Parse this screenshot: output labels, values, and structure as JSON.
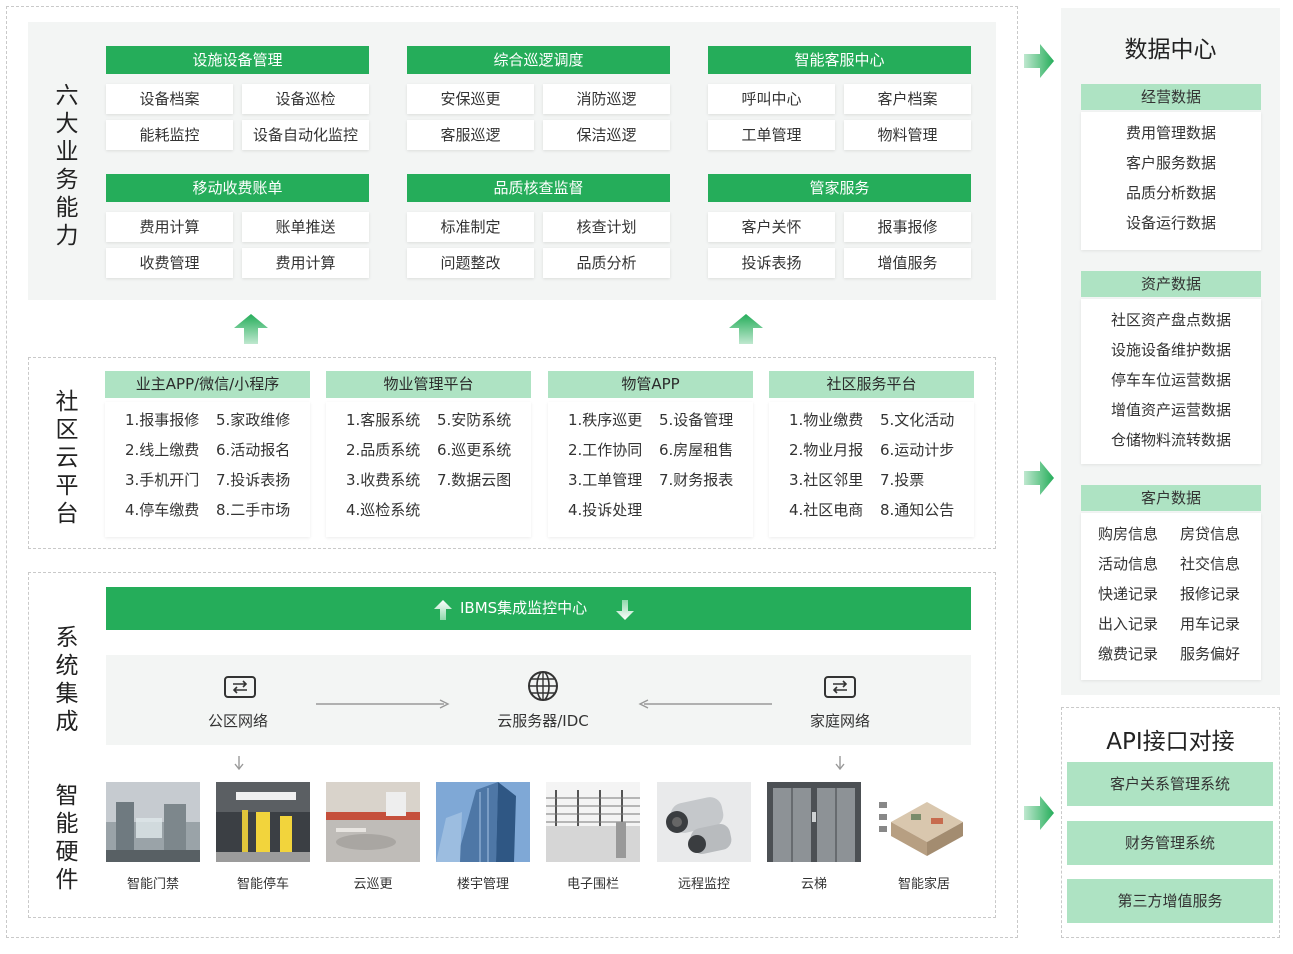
{
  "layers": {
    "business": "六大业务能力",
    "cloud": "社区云平台",
    "integration": "系统集成",
    "hardware": "智能硬件"
  },
  "business_groups": [
    {
      "title": "设施设备管理",
      "items": [
        "设备档案",
        "设备巡检",
        "能耗监控",
        "设备自动化监控"
      ]
    },
    {
      "title": "综合巡逻调度",
      "items": [
        "安保巡更",
        "消防巡逻",
        "客服巡逻",
        "保洁巡逻"
      ]
    },
    {
      "title": "智能客服中心",
      "items": [
        "呼叫中心",
        "客户档案",
        "工单管理",
        "物料管理"
      ]
    },
    {
      "title": "移动收费账单",
      "items": [
        "费用计算",
        "账单推送",
        "收费管理",
        "费用计算"
      ]
    },
    {
      "title": "品质核查监督",
      "items": [
        "标准制定",
        "核查计划",
        "问题整改",
        "品质分析"
      ]
    },
    {
      "title": "管家服务",
      "items": [
        "客户关怀",
        "报事报修",
        "投诉表扬",
        "增值服务"
      ]
    }
  ],
  "platforms": [
    {
      "title": "业主APP/微信/小程序",
      "left": [
        "1.报事报修",
        "2.线上缴费",
        "3.手机开门",
        "4.停车缴费"
      ],
      "right": [
        "5.家政维修",
        "6.活动报名",
        "7.投诉表扬",
        "8.二手市场"
      ]
    },
    {
      "title": "物业管理平台",
      "left": [
        "1.客服系统",
        "2.品质系统",
        "3.收费系统",
        "4.巡检系统"
      ],
      "right": [
        "5.安防系统",
        "6.巡更系统",
        "7.数据云图"
      ]
    },
    {
      "title": "物管APP",
      "left": [
        "1.秩序巡更",
        "2.工作协同",
        "3.工单管理",
        "4.投诉处理"
      ],
      "right": [
        "5.设备管理",
        "6.房屋租售",
        "7.财务报表"
      ]
    },
    {
      "title": "社区服务平台",
      "left": [
        "1.物业缴费",
        "2.物业月报",
        "3.社区邻里",
        "4.社区电商"
      ],
      "right": [
        "5.文化活动",
        "6.运动计步",
        "7.投票",
        "8.通知公告"
      ]
    }
  ],
  "ibms": "IBMS集成监控中心",
  "network": {
    "public": "公区网络",
    "cloud": "云服务器/IDC",
    "home": "家庭网络"
  },
  "hardware": [
    "智能门禁",
    "智能停车",
    "云巡更",
    "楼宇管理",
    "电子围栏",
    "远程监控",
    "云梯",
    "智能家居"
  ],
  "data_center": {
    "title": "数据中心",
    "groups": [
      {
        "title": "经营数据",
        "items": [
          "费用管理数据",
          "客户服务数据",
          "品质分析数据",
          "设备运行数据"
        ]
      },
      {
        "title": "资产数据",
        "items": [
          "社区资产盘点数据",
          "设施设备维护数据",
          "停车车位运营数据",
          "增值资产运营数据",
          "仓储物料流转数据"
        ]
      },
      {
        "title": "客户数据",
        "left": [
          "购房信息",
          "活动信息",
          "快递记录",
          "出入记录",
          "缴费记录"
        ],
        "right": [
          "房贷信息",
          "社交信息",
          "报修记录",
          "用车记录",
          "服务偏好"
        ]
      }
    ]
  },
  "api": {
    "title": "API接口对接",
    "items": [
      "客户关系管理系统",
      "财务管理系统",
      "第三方增值服务"
    ]
  },
  "colors": {
    "primary": "#25ad5a",
    "light": "#aee3c3",
    "panel": "#f3f5f4"
  }
}
